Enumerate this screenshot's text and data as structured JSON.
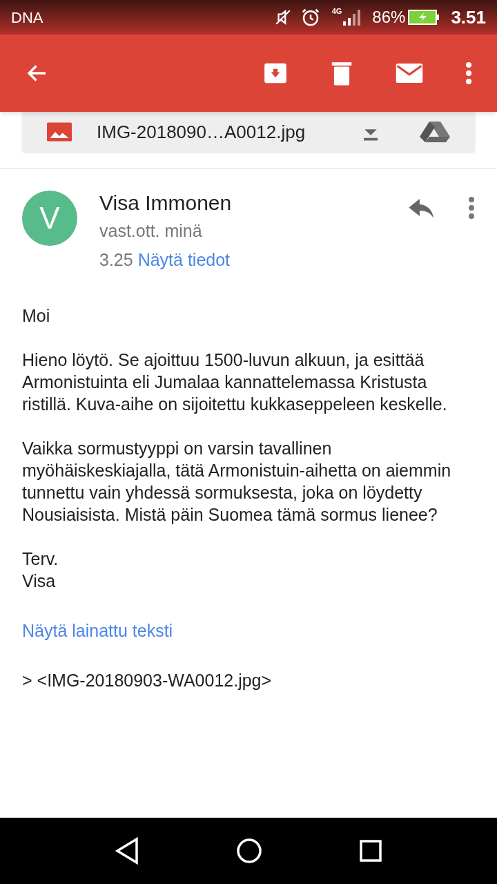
{
  "status_bar": {
    "carrier": "DNA",
    "network": "4G",
    "battery": "86%",
    "time": "3.51"
  },
  "attachment": {
    "filename": "IMG-2018090…A0012.jpg"
  },
  "message": {
    "avatar_letter": "V",
    "sender": "Visa Immonen",
    "recipient": "vast.ott. minä",
    "time": "3.25",
    "details_link": "Näytä tiedot",
    "paragraphs": [
      "Moi",
      "Hieno löytö. Se ajoittuu 1500-luvun alkuun, ja esittää Armonistuinta eli Jumalaa kannattelemassa Kristusta ristillä. Kuva-aihe on sijoitettu kukkaseppeleen keskelle.",
      "Vaikka sormustyyppi on varsin tavallinen myöhäiskeskiajalla, tätä Armonistuin-aihetta on aiemmin tunnettu vain yhdessä sormuksesta, joka on löydetty Nousiaisista. Mistä päin Suomea tämä sormus lienee?"
    ],
    "signature": [
      "Terv.",
      "Visa"
    ],
    "quoted_link": "Näytä lainattu teksti",
    "quoted_text": "> <IMG-20180903-WA0012.jpg>"
  }
}
